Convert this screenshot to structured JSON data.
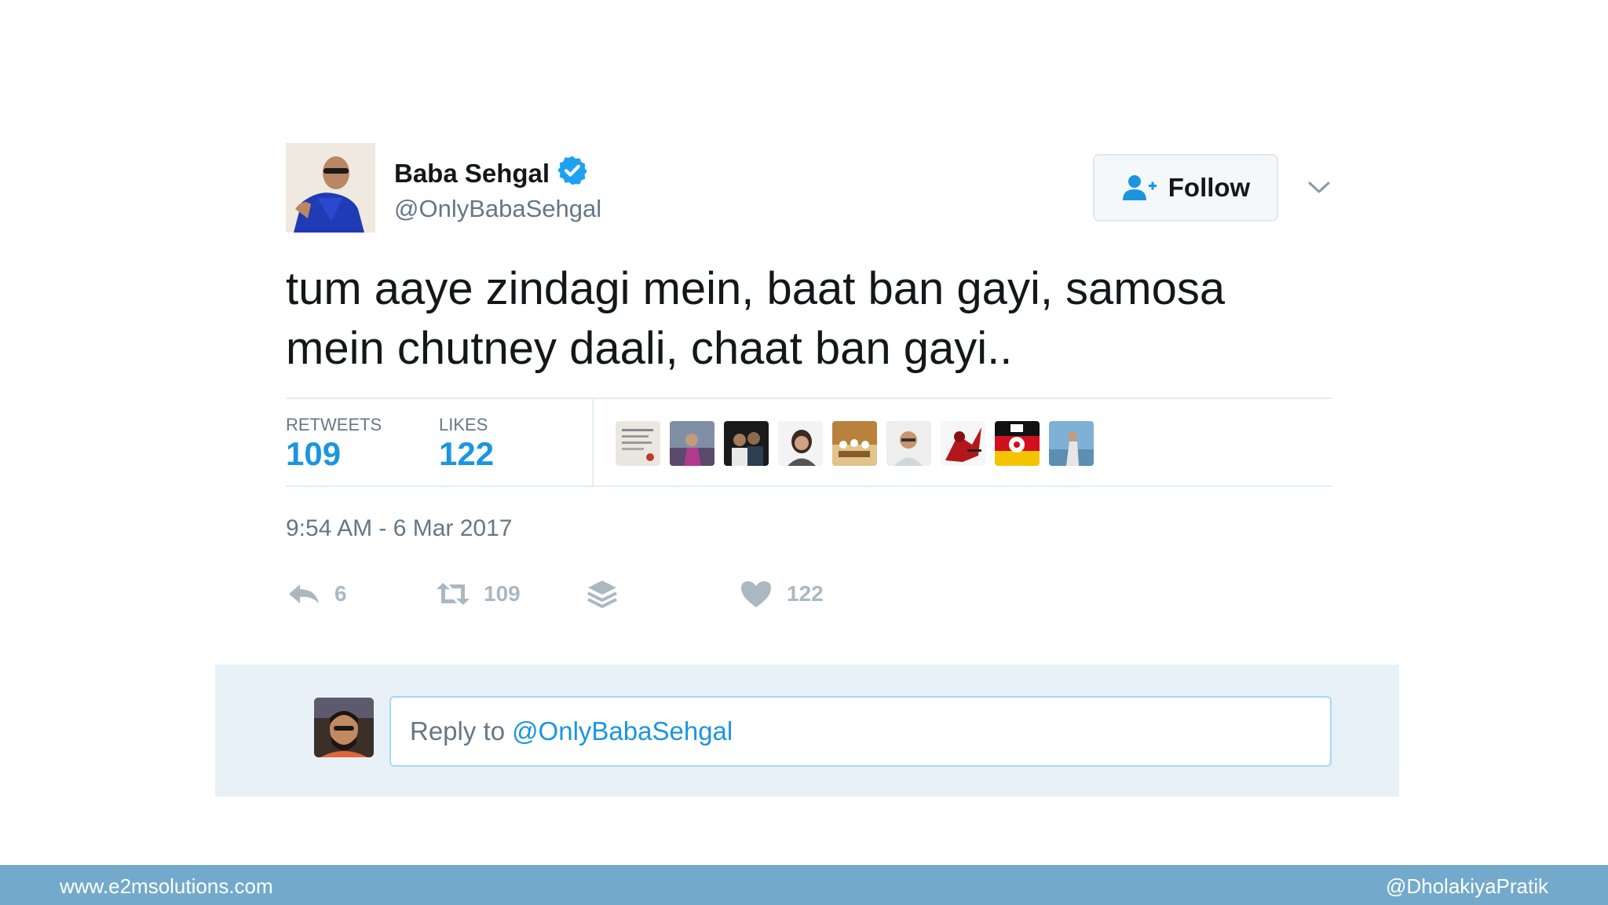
{
  "tweet": {
    "author_name": "Baba Sehgal",
    "author_handle": "@OnlyBabaSehgal",
    "follow_label": "Follow",
    "text": "tum aaye zindagi mein, baat ban gayi, samosa\nmein chutney daali, chaat ban gayi..",
    "stats": {
      "retweets_label": "RETWEETS",
      "retweets_value": "109",
      "likes_label": "LIKES",
      "likes_value": "122"
    },
    "timestamp": "9:54 AM - 6 Mar 2017",
    "actions": {
      "reply_count": "6",
      "retweet_count": "109",
      "like_count": "122"
    }
  },
  "reply_box": {
    "prefix": "Reply to",
    "mention": "@OnlyBabaSehgal"
  },
  "footer": {
    "website": "www.e2msolutions.com",
    "handle": "@DholakiyaPratik"
  },
  "colors": {
    "accent": "#1b95e0",
    "verified": "#1da1f2",
    "muted": "#657786",
    "footer_bar": "#73aacb",
    "reply_area": "#e8f1f8"
  },
  "icons": [
    "verified-badge-icon",
    "follow-user-icon",
    "chevron-down-icon",
    "reply-icon",
    "retweet-icon",
    "stack-icon",
    "heart-icon"
  ]
}
